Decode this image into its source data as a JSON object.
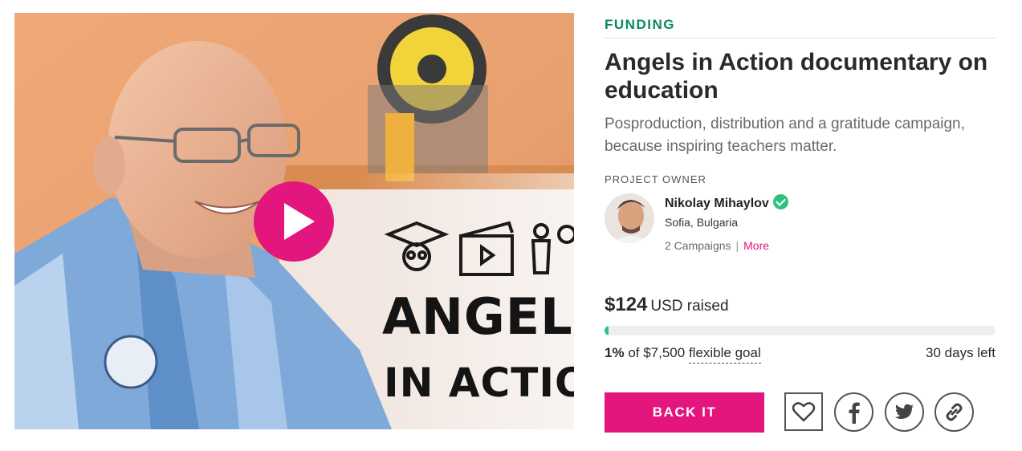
{
  "media": {
    "video_title_line1": "ANGELS",
    "video_title_line2": "IN ACTION",
    "icons": [
      "graduation-cap-icon",
      "clapperboard-icon",
      "idea-person-icon"
    ]
  },
  "campaign": {
    "category": "FUNDING",
    "title": "Angels in Action documentary on education",
    "subtitle": "Posproduction, distribution and a gratitude campaign, because inspiring teachers matter."
  },
  "owner": {
    "heading": "PROJECT OWNER",
    "name": "Nikolay Mihaylov",
    "location": "Sofia, Bulgaria",
    "campaigns": "2 Campaigns",
    "separator": "|",
    "more_label": "More"
  },
  "funding": {
    "amount": "$124",
    "currency_label": "USD raised",
    "percent": "1%",
    "progress_fraction": 0.01,
    "goal_prefix": "of $7,500",
    "goal_type": "flexible goal",
    "days_left": "30 days left"
  },
  "actions": {
    "back_label": "BACK IT",
    "follow_icon": "heart-icon",
    "share_icons": [
      "facebook-icon",
      "twitter-icon",
      "link-icon"
    ]
  },
  "colors": {
    "accent": "#e2167c",
    "category": "#0a8a5f",
    "progress": "#2ec27e"
  }
}
